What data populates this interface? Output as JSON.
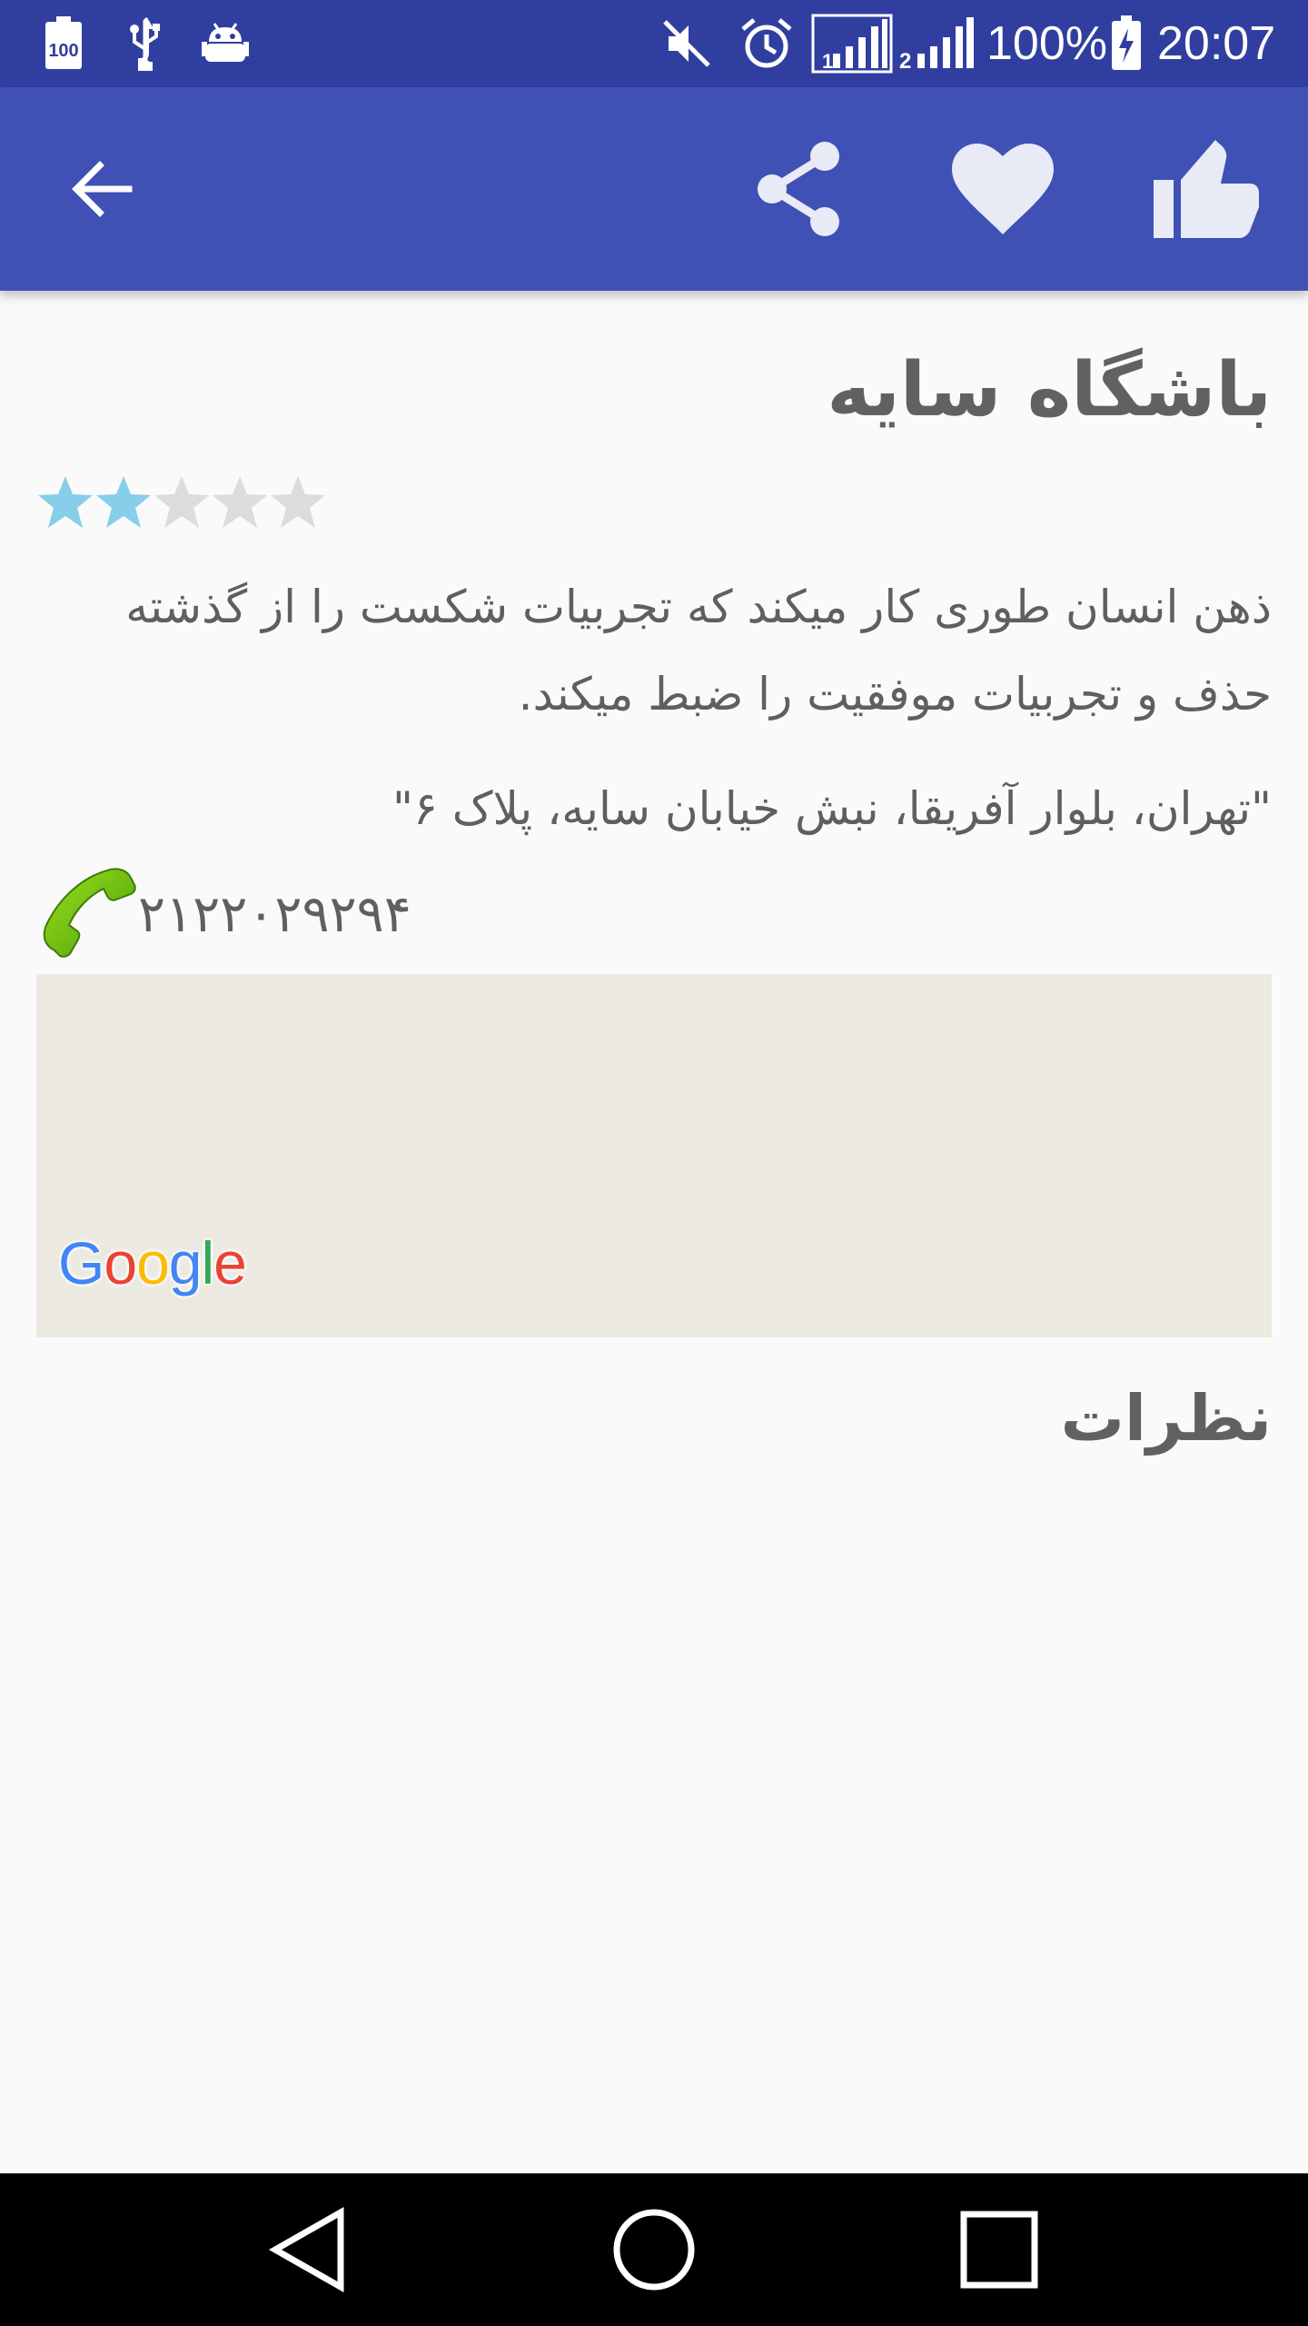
{
  "status_bar": {
    "battery_percent": "100%",
    "time": "20:07",
    "left_icons": [
      "battery-100-icon",
      "usb-icon",
      "android-debug-icon"
    ],
    "right_icons": [
      "mute-icon",
      "alarm-icon",
      "signal-sim1-icon",
      "signal-sim2-icon",
      "battery-charging-icon"
    ],
    "sim1_label": "1",
    "sim2_label": "2"
  },
  "app_bar": {
    "color": "#3f51b5",
    "actions": [
      "back-arrow-icon",
      "share-icon",
      "heart-icon",
      "thumbs-up-icon"
    ]
  },
  "place": {
    "title": "باشگاه سایه",
    "rating": 2,
    "rating_max": 5,
    "star_filled_color": "#87ceeb",
    "star_empty_color": "#dcdcdc",
    "description": "ذهن انسان طوری کار میکند که تجربیات شکست را از گذشته حذف و تجربیات موفقیت را ضبط میکند.",
    "address": "\"تهران، بلوار آفریقا، نبش خیابان سایه، پلاک ۶\"",
    "phone": "۲۱۲۲۰۲۹۲۹۴"
  },
  "map": {
    "background": "#ece9e1",
    "logo_text": "Google"
  },
  "comments": {
    "heading": "نظرات"
  },
  "nav_bar": {
    "buttons": [
      "back-triangle-icon",
      "home-circle-icon",
      "recents-square-icon"
    ]
  }
}
